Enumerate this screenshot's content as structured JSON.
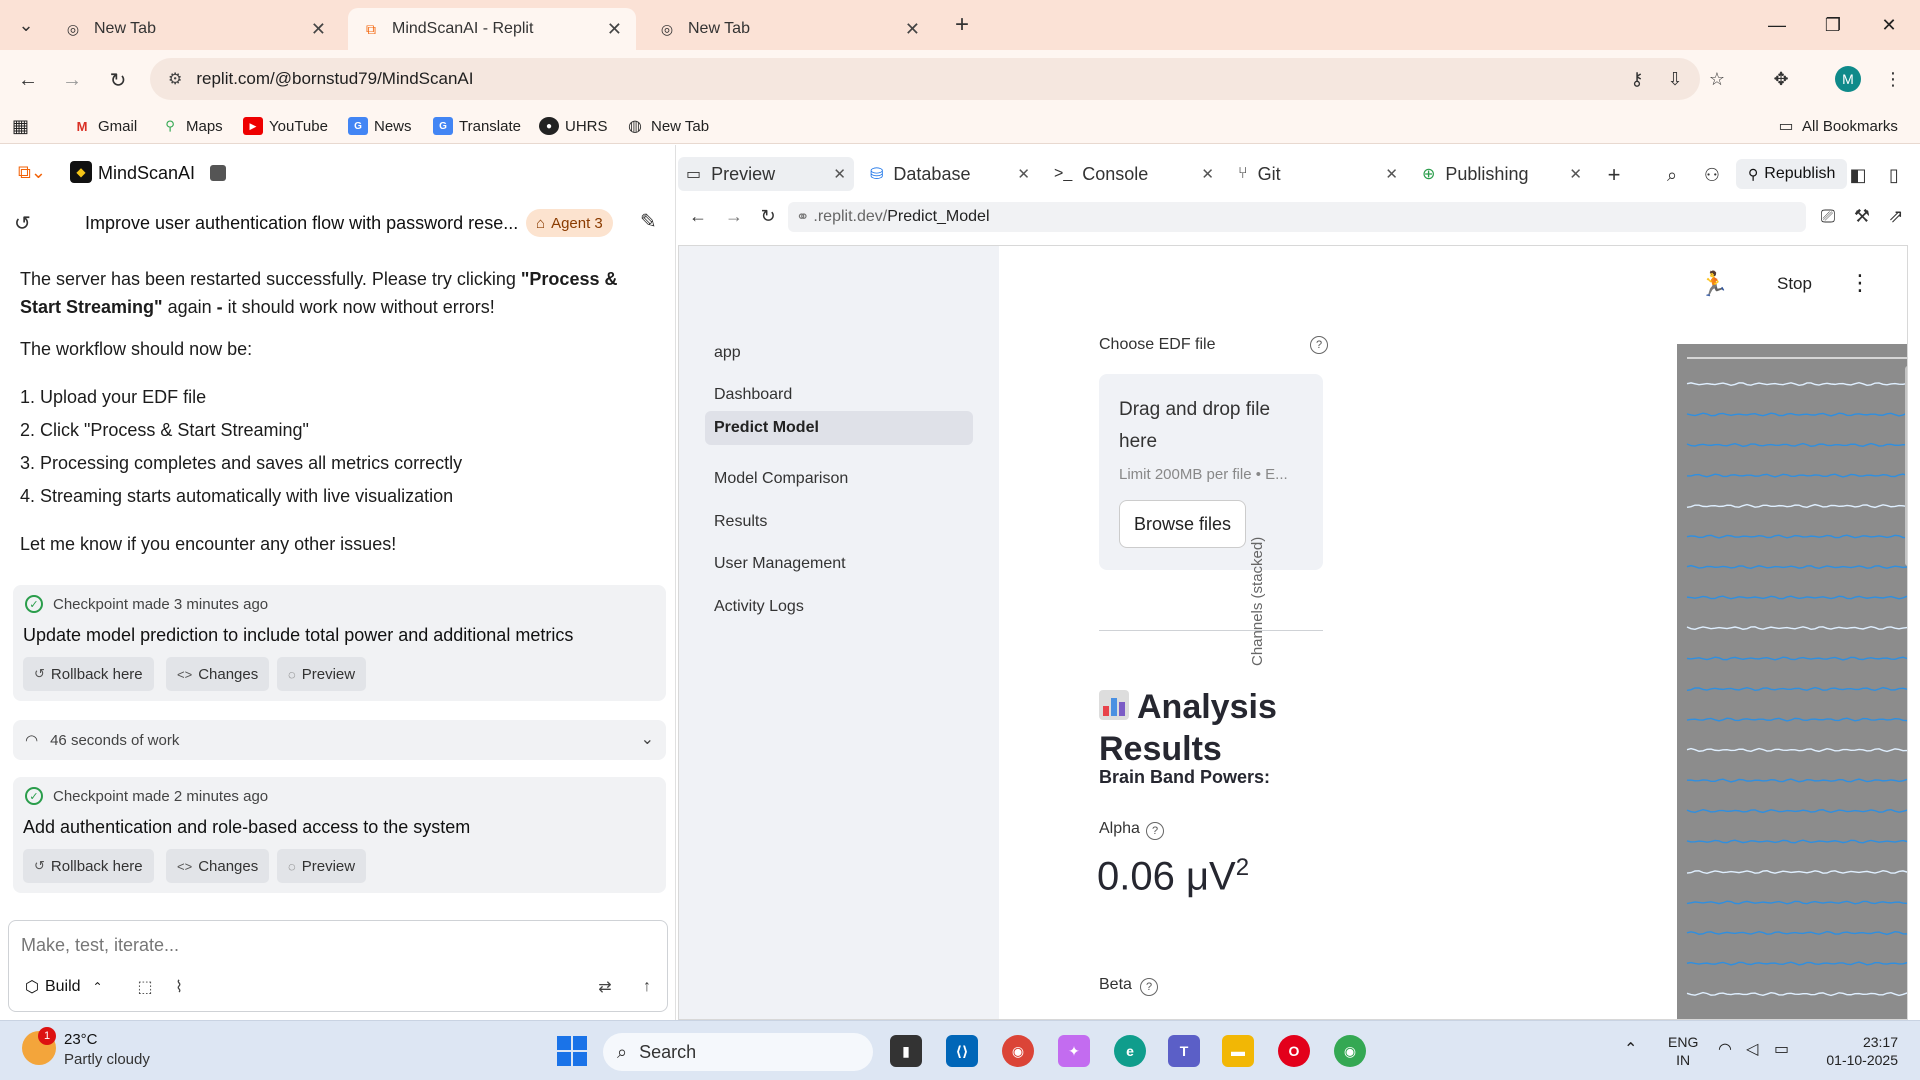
{
  "browser": {
    "tabs": [
      {
        "title": "New Tab",
        "active": false
      },
      {
        "title": "MindScanAI - Replit",
        "active": true
      },
      {
        "title": "New Tab",
        "active": false
      }
    ],
    "url": "replit.com/@bornstud79/MindScanAI",
    "bookmarks": [
      "Gmail",
      "Maps",
      "YouTube",
      "News",
      "Translate",
      "UHRS",
      "New Tab"
    ],
    "all_bookmarks": "All Bookmarks",
    "profile_initial": "M"
  },
  "replit": {
    "app_name": "MindScanAI",
    "task_title": "Improve user authentication flow with password rese...",
    "agent_badge": "Agent 3",
    "chat": {
      "msg1_a": "The server has been restarted successfully. Please try clicking ",
      "msg1_bold": "\"Process & Start Streaming\"",
      "msg1_b": " again ",
      "msg1_dash": "-",
      "msg1_c": " it should work now without errors!",
      "msg2": "The workflow should now be:",
      "steps": [
        "1. Upload your EDF file",
        "2. Click \"Process & Start Streaming\"",
        "3. Processing completes and saves all metrics correctly",
        "4. Streaming starts automatically with live visualization"
      ],
      "msg3": "Let me know if you encounter any other issues!"
    },
    "checkpoints": [
      {
        "time": "Checkpoint made 3 minutes ago",
        "title": "Update model prediction to include total power and additional metrics"
      },
      {
        "time": "Checkpoint made 2 minutes ago",
        "title": "Add authentication and role-based access to the system"
      }
    ],
    "checkpoint_buttons": {
      "rollback": "Rollback here",
      "changes": "Changes",
      "preview": "Preview"
    },
    "work_summary": "46 seconds of work",
    "composer": {
      "placeholder": "Make, test, iterate...",
      "mode": "Build"
    },
    "right_tabs": [
      "Preview",
      "Database",
      "Console",
      "Git",
      "Publishing"
    ],
    "republish": "Republish",
    "preview_url_domain": ".replit.dev/",
    "preview_url_path": "Predict_Model"
  },
  "app": {
    "nav": [
      "app",
      "Dashboard",
      "Predict Model",
      "Model Comparison",
      "Results",
      "User Management",
      "Activity Logs"
    ],
    "active_nav": "Predict Model",
    "stop_label": "Stop",
    "upload_label": "Choose EDF file",
    "dropzone_title": "Drag and drop file here",
    "dropzone_limit": "Limit 200MB per file • E...",
    "browse_label": "Browse files",
    "section_title": "Analysis Results",
    "band_heading": "Brain Band Powers:",
    "metrics": [
      {
        "label": "Alpha",
        "value": "0.06 μV",
        "sup": "2"
      },
      {
        "label": "Beta",
        "value": "",
        "sup": ""
      }
    ],
    "plot_ylabel": "Channels (stacked)"
  },
  "taskbar": {
    "weather_temp": "23°C",
    "weather_cond": "Partly cloudy",
    "weather_badge": "1",
    "search": "Search",
    "lang_1": "ENG",
    "lang_2": "IN",
    "time": "23:17",
    "date": "01-10-2025"
  }
}
